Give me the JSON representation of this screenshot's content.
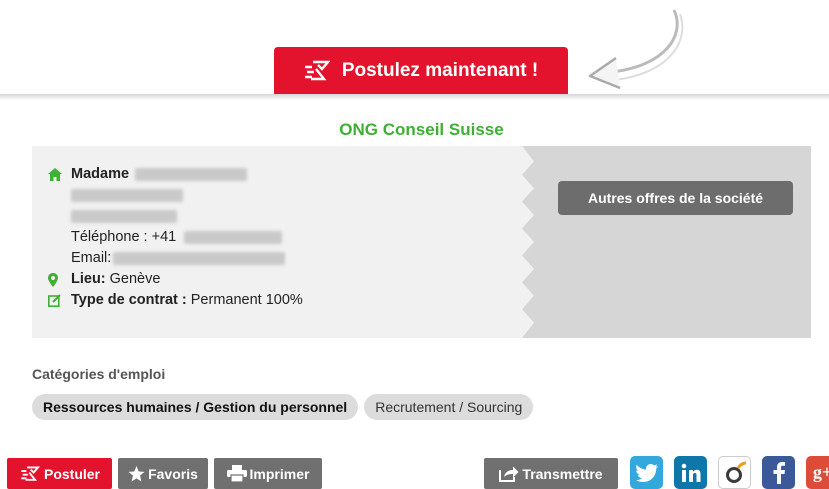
{
  "header": {
    "apply_label": "Postulez maintenant !"
  },
  "company": {
    "name": "ONG Conseil Suisse"
  },
  "contact": {
    "salutation": "Madame",
    "phone_label": "Téléphone : +41",
    "email_label": "Email:",
    "location_label": "Lieu:",
    "location_value": "Genève",
    "contract_label": "Type de contrat :",
    "contract_value": "Permanent 100%"
  },
  "sidebar": {
    "other_offers_label": "Autres offres de la société"
  },
  "categories": {
    "title": "Catégories d'emploi",
    "tags": [
      "Ressources humaines / Gestion du personnel",
      "Recrutement / Sourcing"
    ]
  },
  "footer": {
    "apply_label": "Postuler",
    "favorites_label": "Favoris",
    "print_label": "Imprimer",
    "forward_label": "Transmettre"
  },
  "icons": {
    "home": "home-icon",
    "location": "map-marker-icon",
    "contract": "edit-icon",
    "apply": "send-mail-icon",
    "favorites": "star-icon",
    "print": "printer-icon",
    "forward": "share-icon",
    "social": [
      "twitter-icon",
      "linkedin-icon",
      "odnoklassniki-icon",
      "facebook-icon",
      "google-plus-icon"
    ]
  },
  "colors": {
    "accent_red": "#e3132d",
    "company_green": "#3eb033",
    "button_grey": "#707070",
    "twitter": "#33a8dd",
    "linkedin": "#0e76a8",
    "odnoklassniki": "#f39a1e",
    "facebook": "#3b5998",
    "google": "#dd4b39"
  }
}
